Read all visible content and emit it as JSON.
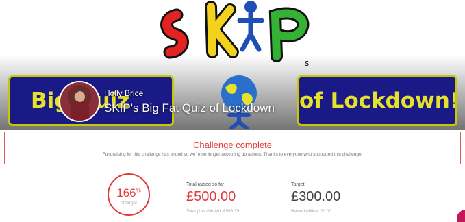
{
  "banner": {
    "logo_text": "SKIP's",
    "quiz_left_text": "Big Quiz",
    "quiz_right_text": "of Lockdown!",
    "owner_name": "Holly Brice",
    "page_title": "SKIP's Big Fat Quiz of Lockdown"
  },
  "status": {
    "title": "Challenge complete",
    "message": "Fundraising for this challenge has ended so we're no longer accepting donations. Thanks to everyone who supported this challenge."
  },
  "progress": {
    "percent": "166",
    "percent_sign": "%",
    "label": "of target"
  },
  "total": {
    "label": "Total raised so far",
    "amount": "£500.00",
    "gift_aid": "Total plus Gift Aid: £598.75"
  },
  "target": {
    "label": "Target",
    "amount": "£300.00",
    "offline": "Raised offline: £0.00"
  },
  "colors": {
    "accent_red": "#e23a3a",
    "quiz_panel_blue": "#1a1a86",
    "quiz_panel_yellow": "#e6e12a"
  }
}
